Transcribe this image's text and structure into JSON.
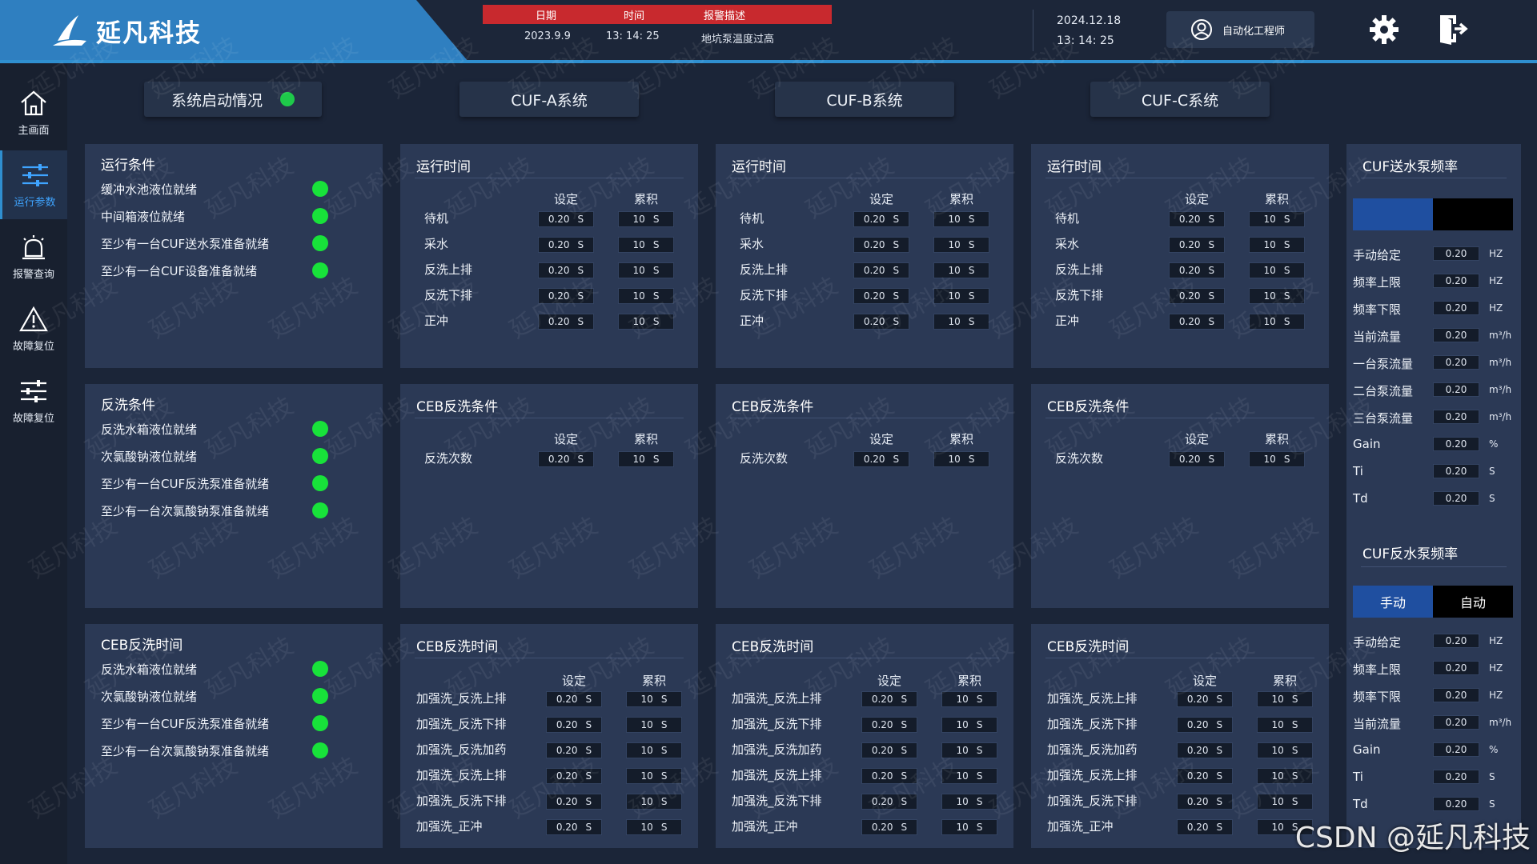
{
  "app": {
    "logo_text": "延凡科技"
  },
  "alarm": {
    "headers": [
      "日期",
      "时间",
      "报警描述"
    ],
    "row": {
      "date": "2023.9.9",
      "time": "13: 14: 25",
      "desc": "地坑泵温度过高"
    },
    "color": "#c8292e"
  },
  "clock": {
    "date": "2024.12.18",
    "time": "13: 14: 25"
  },
  "user": {
    "name": "自动化工程师"
  },
  "icons": {
    "settings": "gear-icon",
    "logout": "logout-icon",
    "user": "user-icon"
  },
  "sidebar": [
    {
      "label": "主画面",
      "icon": "home-icon",
      "active": false
    },
    {
      "label": "运行参数",
      "icon": "sliders-icon",
      "active": true
    },
    {
      "label": "报警查询",
      "icon": "alarm-icon",
      "active": false
    },
    {
      "label": "故障复位",
      "icon": "warning-icon",
      "active": false
    },
    {
      "label": "故障复位",
      "icon": "sliders-icon",
      "active": false
    }
  ],
  "tabs": {
    "status": "系统启动情况",
    "a": "CUF-A系统",
    "b": "CUF-B系统",
    "c": "CUF-C系统"
  },
  "left_panels": [
    {
      "title": "运行条件",
      "items": [
        "缓冲水池液位就绪",
        "中间箱液位就绪",
        "至少有一台CUF送水泵准备就绪",
        "至少有一台CUF设备准备就绪"
      ]
    },
    {
      "title": "反洗条件",
      "items": [
        "反洗水箱液位就绪",
        "次氯酸钠液位就绪",
        "至少有一台CUF反洗泵准备就绪",
        "至少有一台次氯酸钠泵准备就绪"
      ]
    },
    {
      "title": "CEB反洗时间",
      "items": [
        "反洗水箱液位就绪",
        "次氯酸钠液位就绪",
        "至少有一台CUF反洗泵准备就绪",
        "至少有一台次氯酸钠泵准备就绪"
      ]
    }
  ],
  "col_set": "设定",
  "col_acc": "累积",
  "unit_s": "S",
  "run_panel": {
    "title": "运行时间",
    "rows": [
      {
        "label": "待机",
        "set": "0.20",
        "acc": "10"
      },
      {
        "label": "采水",
        "set": "0.20",
        "acc": "10"
      },
      {
        "label": "反洗上排",
        "set": "0.20",
        "acc": "10"
      },
      {
        "label": "反洗下排",
        "set": "0.20",
        "acc": "10"
      },
      {
        "label": "正冲",
        "set": "0.20",
        "acc": "10"
      }
    ]
  },
  "ceb_cond_panel": {
    "title": "CEB反洗条件",
    "rows": [
      {
        "label": "反洗次数",
        "set": "0.20",
        "acc": "10"
      }
    ]
  },
  "ceb_time_panel": {
    "title": "CEB反洗时间",
    "rows": [
      {
        "label": "加强洗_反洗上排",
        "set": "0.20",
        "acc": "10"
      },
      {
        "label": "加强洗_反洗下排",
        "set": "0.20",
        "acc": "10"
      },
      {
        "label": "加强洗_反洗加药",
        "set": "0.20",
        "acc": "10"
      },
      {
        "label": "加强洗_反洗上排",
        "set": "0.20",
        "acc": "10"
      },
      {
        "label": "加强洗_反洗下排",
        "set": "0.20",
        "acc": "10"
      },
      {
        "label": "加强洗_正冲",
        "set": "0.20",
        "acc": "10"
      }
    ]
  },
  "right": {
    "feed_title": "CUF送水泵频率",
    "feed_rows": [
      {
        "label": "手动给定",
        "value": "0.20",
        "unit": "HZ"
      },
      {
        "label": "频率上限",
        "value": "0.20",
        "unit": "HZ"
      },
      {
        "label": "频率下限",
        "value": "0.20",
        "unit": "HZ"
      },
      {
        "label": "当前流量",
        "value": "0.20",
        "unit": "m³/h"
      },
      {
        "label": "一台泵流量",
        "value": "0.20",
        "unit": "m³/h"
      },
      {
        "label": "二台泵流量",
        "value": "0.20",
        "unit": "m³/h"
      },
      {
        "label": "三台泵流量",
        "value": "0.20",
        "unit": "m³/h"
      },
      {
        "label": "Gain",
        "value": "0.20",
        "unit": "%"
      },
      {
        "label": "Ti",
        "value": "0.20",
        "unit": "S"
      },
      {
        "label": "Td",
        "value": "0.20",
        "unit": "S"
      }
    ],
    "back_title": "CUF反水泵频率",
    "manual": "手动",
    "auto": "自动",
    "back_rows": [
      {
        "label": "手动给定",
        "value": "0.20",
        "unit": "HZ"
      },
      {
        "label": "频率上限",
        "value": "0.20",
        "unit": "HZ"
      },
      {
        "label": "频率下限",
        "value": "0.20",
        "unit": "HZ"
      },
      {
        "label": "当前流量",
        "value": "0.20",
        "unit": "m³/h"
      },
      {
        "label": "Gain",
        "value": "0.20",
        "unit": "%"
      },
      {
        "label": "Ti",
        "value": "0.20",
        "unit": "S"
      },
      {
        "label": "Td",
        "value": "0.20",
        "unit": "S"
      }
    ]
  },
  "colors": {
    "ok": "#18e23a",
    "accent": "#2f8fd0",
    "panel": "#2b3955",
    "bg": "#1b2538"
  },
  "watermark": "延凡科技",
  "footer": "CSDN @延凡科技"
}
